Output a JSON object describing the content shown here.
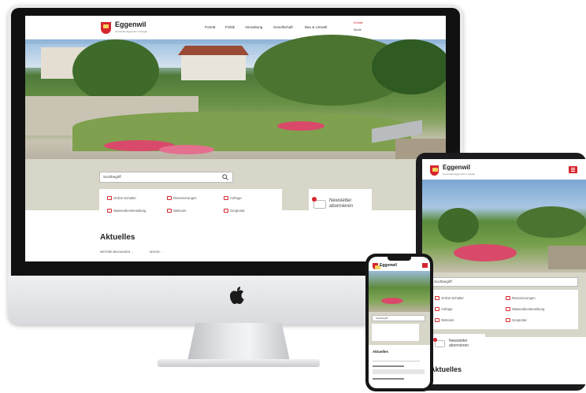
{
  "site": {
    "name": "Eggenwil",
    "subtitle": "Gemeinde Eggenwil im Aargau",
    "nav": [
      "Porträt",
      "Politik",
      "Verwaltung",
      "Gesellschaft",
      "Bau & Umwelt"
    ],
    "utility": [
      "Kontakt",
      "Suche"
    ],
    "search_placeholder": "Suchbegriff",
    "quicklinks": [
      {
        "label": "Online-Schalter",
        "icon": "desk-icon"
      },
      {
        "label": "Reservierungen",
        "icon": "calendar-icon"
      },
      {
        "label": "Anfrage",
        "icon": "house-icon"
      },
      {
        "label": "Wasserdienstmeldung",
        "icon": "water-icon"
      },
      {
        "label": "Webcam",
        "icon": "camera-icon"
      },
      {
        "label": "Geoportal",
        "icon": "map-icon"
      }
    ],
    "newsletter": "Newsletter abonnieren",
    "news_title": "Aktuelles",
    "news_links": [
      "WEITERE MELDUNGEN →",
      "ARCHIV →"
    ]
  },
  "colors": {
    "accent": "#d6262d",
    "beige": "#d7d6c8"
  }
}
